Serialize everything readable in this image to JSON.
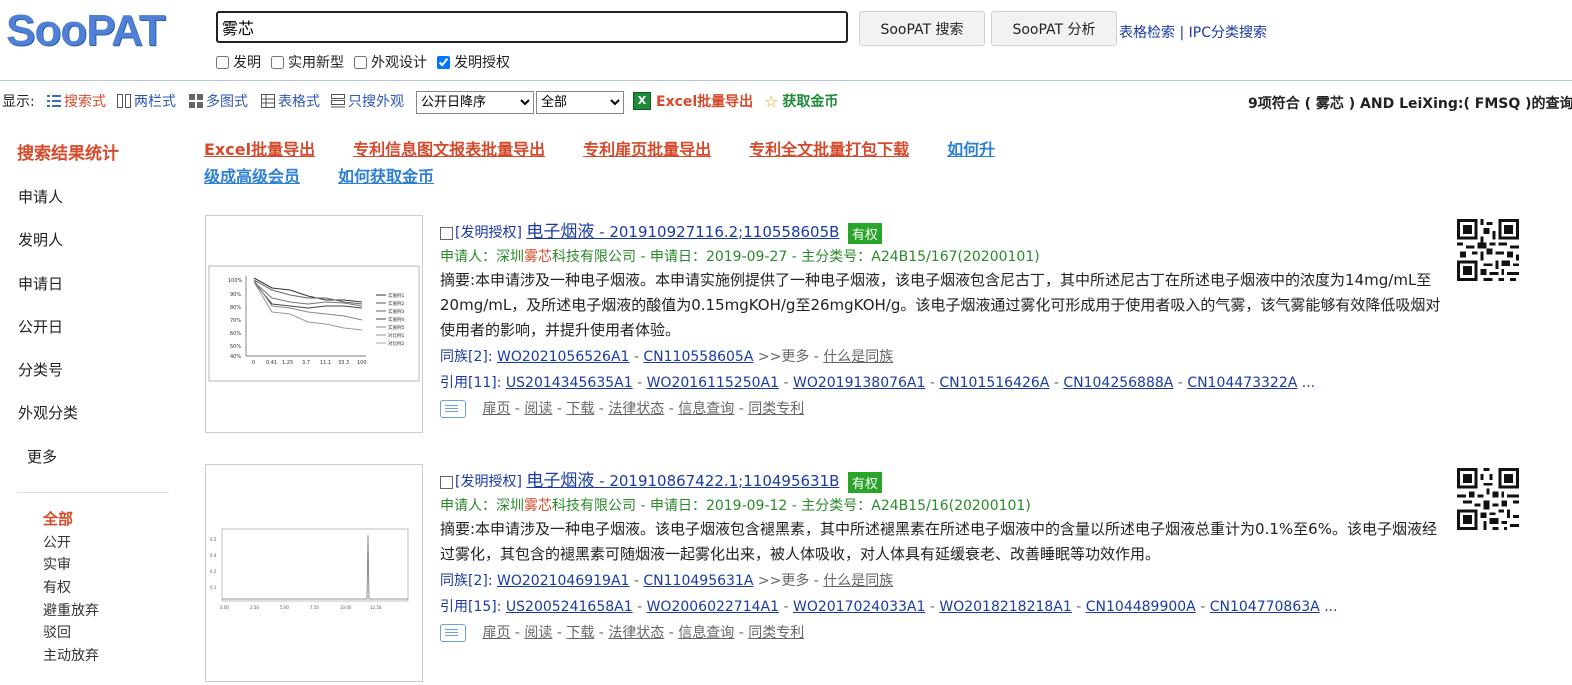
{
  "brand": {
    "logo_text": "SooPAT",
    "brand_color": "#4f80d6"
  },
  "search": {
    "query": "雾芯",
    "search_button": "SooPAT 搜索",
    "analyze_button": "SooPAT 分析"
  },
  "top_links": {
    "table_search": "表格检索",
    "separator": "|",
    "ipc_search": "IPC分类搜索"
  },
  "filters": [
    {
      "label": "发明",
      "checked": false
    },
    {
      "label": "实用新型",
      "checked": false
    },
    {
      "label": "外观设计",
      "checked": false
    },
    {
      "label": "发明授权",
      "checked": true
    }
  ],
  "toolbar": {
    "display_label": "显示:",
    "views": [
      "搜索式",
      "两栏式",
      "多图式",
      "表格式",
      "只搜外观"
    ],
    "sort_value": "公开日降序",
    "scope_value": "全部",
    "excel_export": "Excel批量导出",
    "get_coins": "获取金币",
    "result_count_num": "9",
    "result_count_text": "项符合 ( 雾芯 ) AND LeiXing:( FMSQ )的查询"
  },
  "sidebar": {
    "title": "搜索结果统计",
    "items": [
      "申请人",
      "发明人",
      "申请日",
      "公开日",
      "分类号",
      "外观分类"
    ],
    "more": "更多",
    "status_items": [
      "全部",
      "公开",
      "实审",
      "有权",
      "避重放弃",
      "驳回",
      "主动放弃"
    ]
  },
  "exports": {
    "links": [
      "Excel批量导出",
      "专利信息图文报表批量导出",
      "专利扉页批量导出",
      "专利全文批量打包下载"
    ],
    "upgrade_a": "如何升",
    "upgrade_b": "级成高级会员",
    "get_coins": "如何获取金币"
  },
  "results": [
    {
      "kind": "[发明授权]",
      "title": "电子烟液",
      "number": " - 201910927116.2;110558605B",
      "status": "有权",
      "applicant_pre": "申请人：深圳",
      "applicant_hl": "雾芯",
      "applicant_post": "科技有限公司 - 申请日：2019-09-27 - 主分类号：A24B15/167(20200101)",
      "abstract": "摘要:本申请涉及一种电子烟液。本申请实施例提供了一种电子烟液，该电子烟液包含尼古丁，其中所述尼古丁在所述电子烟液中的浓度为14mg/mL至20mg/mL，及所述电子烟液的酸值为0.15mgKOH/g至26mgKOH/g。该电子烟液通过雾化可形成用于使用者吸入的气雾，该气雾能够有效降低吸烟对使用者的影响，并提升使用者体验。",
      "family_label": "同族[2]:",
      "family": [
        "WO2021056526A1",
        "CN110558605A"
      ],
      "more": ">>更多",
      "what_family": "什么是同族",
      "cite_label": "引用[11]:",
      "cites": [
        "US2014345635A1",
        "WO2016115250A1",
        "WO2019138076A1",
        "CN101516426A",
        "CN104256888A",
        "CN104473322A"
      ],
      "ellipsis": "..."
    },
    {
      "kind": "[发明授权]",
      "title": "电子烟液",
      "number": " - 201910867422.1;110495631B",
      "status": "有权",
      "applicant_pre": "申请人：深圳",
      "applicant_hl": "雾芯",
      "applicant_post": "科技有限公司 - 申请日：2019-09-12 - 主分类号：A24B15/16(20200101)",
      "abstract": "摘要:本申请涉及一种电子烟液。该电子烟液包含褪黑素，其中所述褪黑素在所述电子烟液中的含量以所述电子烟液总重计为0.1%至6%。该电子烟液经过雾化，其包含的褪黑素可随烟液一起雾化出来，被人体吸收，对人体具有延缓衰老、改善睡眠等功效作用。",
      "family_label": "同族[2]:",
      "family": [
        "WO2021046919A1",
        "CN110495631A"
      ],
      "more": ">>更多",
      "what_family": "什么是同族",
      "cite_label": "引用[15]:",
      "cites": [
        "US2005241658A1",
        "WO2006022714A1",
        "WO2017024033A1",
        "WO2018218218A1",
        "CN104489900A",
        "CN104770863A"
      ],
      "ellipsis": "..."
    }
  ],
  "actions": [
    "扉页",
    "阅读",
    "下载",
    "法律状态",
    "信息查询",
    "同类专利"
  ],
  "thumb1_legend": [
    "实施例1",
    "实施例2",
    "实施例3",
    "实施例4",
    "实施例5",
    "对比例1",
    "对比例2"
  ]
}
